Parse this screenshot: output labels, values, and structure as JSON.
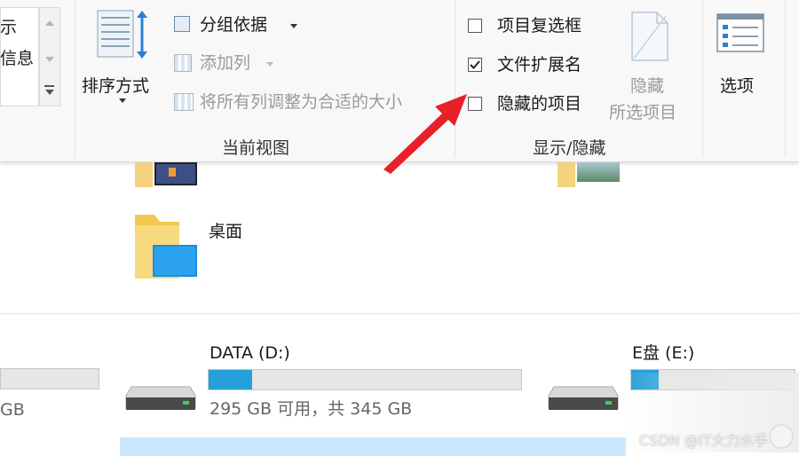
{
  "ribbon": {
    "left_partial": {
      "line1": "示",
      "line2": "信息"
    },
    "sort_group": {
      "sort_by": "排序方式",
      "group_by": "分组依据",
      "add_columns": "添加列",
      "size_all_columns": "将所有列调整为合适的大小",
      "group_label": "当前视图"
    },
    "show_hide": {
      "item_checkboxes": {
        "label": "项目复选框",
        "checked": false
      },
      "file_extensions": {
        "label": "文件扩展名",
        "checked": true
      },
      "hidden_items": {
        "label": "隐藏的项目",
        "checked": false
      },
      "hide_selected_line1": "隐藏",
      "hide_selected_line2": "所选项目",
      "group_label": "显示/隐藏"
    },
    "options": {
      "label": "选项"
    }
  },
  "folders": [
    {
      "name": "桌面"
    }
  ],
  "drives": [
    {
      "name": "",
      "free_text": "GB",
      "used_fraction": 0.0
    },
    {
      "name": "DATA (D:)",
      "free_text": "295 GB 可用，共 345 GB",
      "used_fraction": 0.14
    },
    {
      "name": "E盘 (E:)",
      "free_text": "",
      "used_fraction": 0.17
    }
  ],
  "watermark": "CSDN @IT大力水手",
  "colors": {
    "accent": "#26a0da",
    "arrow": "#e8202a",
    "selection": "#cce8ff"
  }
}
